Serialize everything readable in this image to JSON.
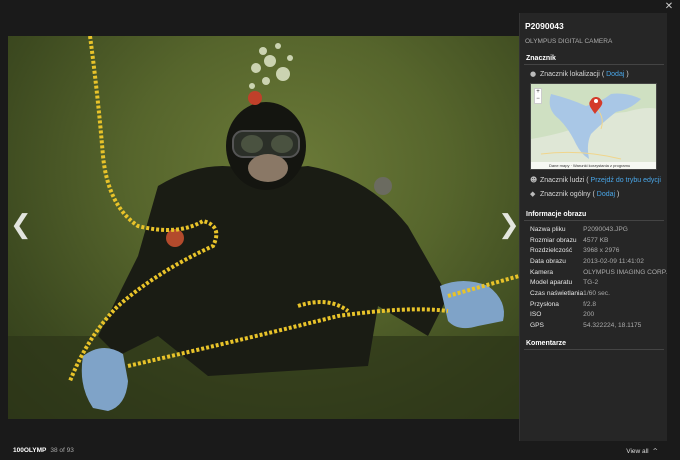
{
  "viewer": {
    "close_glyph": "✕",
    "prev_glyph": "❮",
    "next_glyph": "❯"
  },
  "photo": {
    "description_icon": "diver-photo"
  },
  "panel": {
    "title": "P2090043",
    "subtitle": "OLYMPUS DIGITAL CAMERA",
    "tag_section": {
      "heading": "Znacznik",
      "location": {
        "label": "Znacznik lokalizacji",
        "link": "Dodaj"
      },
      "map": {
        "footer": "Dane mapy · Warunki korzystania z programu",
        "zoom_in": "+",
        "zoom_out": "−"
      },
      "people": {
        "label": "Znacznik ludzi",
        "link": "Przejdź do trybu edycji"
      },
      "general": {
        "label": "Znacznik ogólny",
        "link": "Dodaj"
      }
    },
    "info_section": {
      "heading": "Informacje obrazu",
      "rows": [
        {
          "key": "Nazwa pliku",
          "value": "P2090043.JPG"
        },
        {
          "key": "Rozmiar obrazu",
          "value": "4577 KB"
        },
        {
          "key": "Rozdzielczość",
          "value": "3968 x 2976"
        },
        {
          "key": "Data obrazu",
          "value": "2013-02-09 11:41:02"
        },
        {
          "key": "Kamera",
          "value": "OLYMPUS IMAGING CORP."
        },
        {
          "key": "Model aparatu",
          "value": "TG-2"
        },
        {
          "key": "Czas naświetlania",
          "value": "1/60 sec."
        },
        {
          "key": "Przysłona",
          "value": "f/2.8"
        },
        {
          "key": "ISO",
          "value": "200"
        },
        {
          "key": "GPS",
          "value": "54.322224, 18.1175"
        }
      ]
    },
    "comments_section": {
      "heading": "Komentarze"
    }
  },
  "footer": {
    "album": "100OLYMP",
    "count": "38 of 93",
    "view_all": "View all",
    "view_all_chevron": "^"
  },
  "colors": {
    "link": "#49a6e8",
    "panel_bg": "#262626",
    "page_bg": "#1a1a1a",
    "rope": "#e8c32a"
  }
}
